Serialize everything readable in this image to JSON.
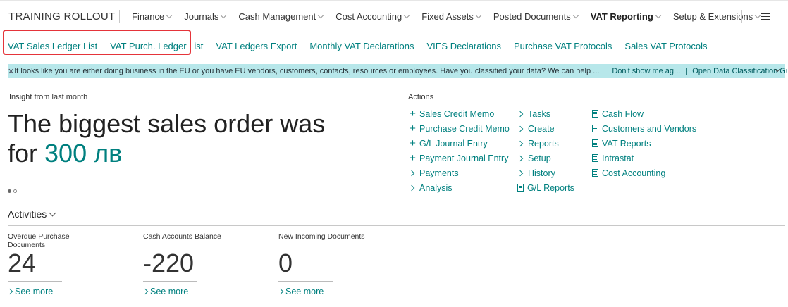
{
  "header": {
    "company": "TRAINING ROLLOUT",
    "menu": [
      {
        "label": "Finance",
        "active": false
      },
      {
        "label": "Journals",
        "active": false
      },
      {
        "label": "Cash Management",
        "active": false
      },
      {
        "label": "Cost Accounting",
        "active": false
      },
      {
        "label": "Fixed Assets",
        "active": false
      },
      {
        "label": "Posted Documents",
        "active": false
      },
      {
        "label": "VAT Reporting",
        "active": true
      },
      {
        "label": "Setup & Extensions",
        "active": false
      }
    ],
    "hamburger_icon": "hamburger-icon"
  },
  "subnav": {
    "items": [
      "VAT Sales Ledger List",
      "VAT Purch. Ledger List",
      "VAT Ledgers Export",
      "Monthly VAT Declarations",
      "VIES Declarations",
      "Purchase VAT Protocols",
      "Sales VAT Protocols"
    ],
    "highlight_color": "#e5343a"
  },
  "banner": {
    "message": "It looks like you are either doing business in the EU or you have EU vendors, customers, contacts, resources or employees. Have you classified your data? We can help ...",
    "link1": "Don't show me ag...",
    "divider": "|",
    "link2": "Open Data Classification Gu...",
    "background": "#b7e7ea"
  },
  "insight": {
    "caption": "Insight from last month",
    "text_line1": "The biggest sales order was",
    "text_for": "for",
    "amount": "300 лв"
  },
  "actions": {
    "title": "Actions",
    "col1": [
      {
        "label": "Sales Credit Memo",
        "icon": "plus-icon"
      },
      {
        "label": "Purchase Credit Memo",
        "icon": "plus-icon"
      },
      {
        "label": "G/L Journal Entry",
        "icon": "plus-icon"
      },
      {
        "label": "Payment Journal Entry",
        "icon": "plus-icon"
      },
      {
        "label": "Payments",
        "icon": "chevron-right-icon"
      },
      {
        "label": "Analysis",
        "icon": "chevron-right-icon"
      }
    ],
    "col2": [
      {
        "label": "Tasks",
        "icon": "chevron-right-icon"
      },
      {
        "label": "Create",
        "icon": "chevron-right-icon"
      },
      {
        "label": "Reports",
        "icon": "chevron-right-icon"
      },
      {
        "label": "Setup",
        "icon": "chevron-right-icon"
      },
      {
        "label": "History",
        "icon": "chevron-right-icon"
      },
      {
        "label": "G/L Reports",
        "icon": "document-icon"
      }
    ],
    "col3": [
      {
        "label": "Cash Flow",
        "icon": "document-icon"
      },
      {
        "label": "Customers and Vendors",
        "icon": "document-icon"
      },
      {
        "label": "VAT Reports",
        "icon": "document-icon"
      },
      {
        "label": "Intrastat",
        "icon": "document-icon"
      },
      {
        "label": "Cost Accounting",
        "icon": "document-icon"
      }
    ]
  },
  "activities": {
    "title": "Activities",
    "tiles": [
      {
        "label": "Overdue Purchase Documents",
        "value": "24",
        "more": "See more"
      },
      {
        "label": "Cash Accounts Balance",
        "value": "-220",
        "more": "See more"
      },
      {
        "label": "New Incoming Documents",
        "value": "0",
        "more": "See more"
      }
    ]
  }
}
